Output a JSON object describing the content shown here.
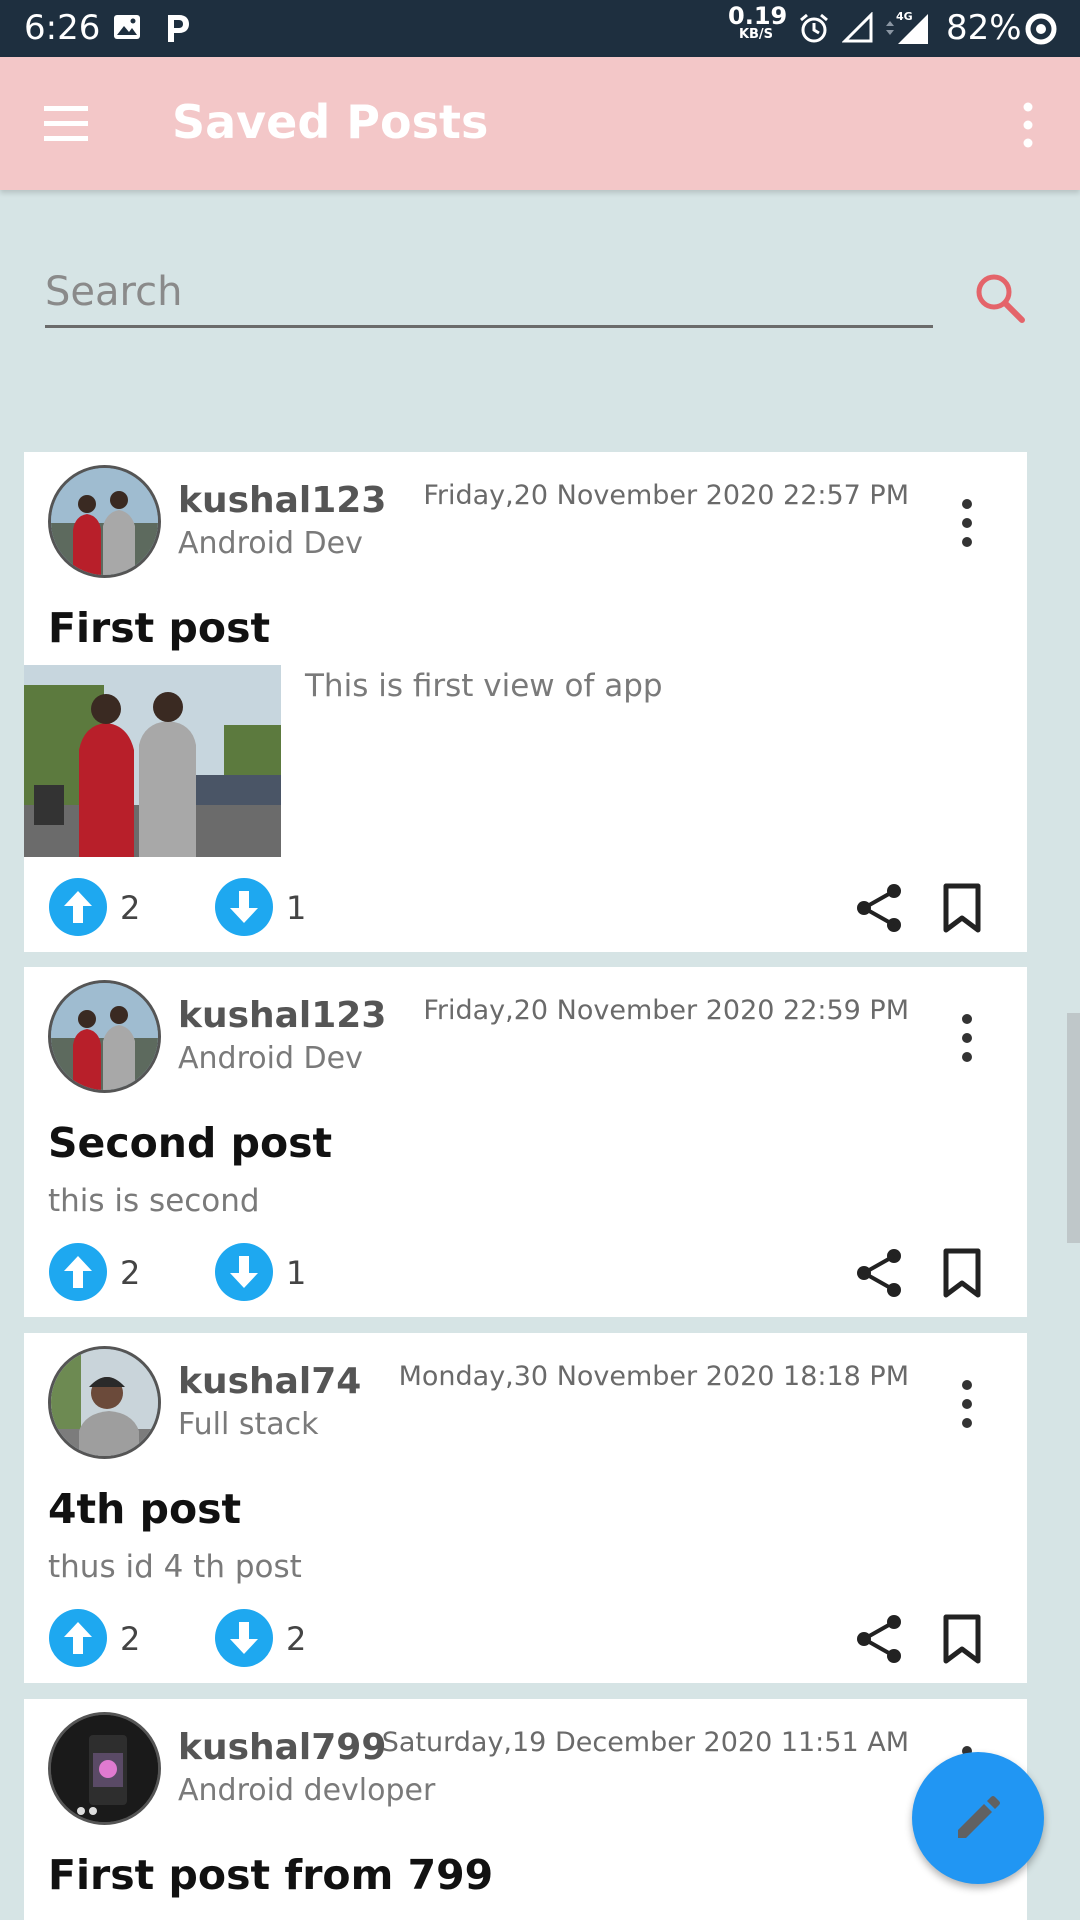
{
  "status_bar": {
    "time": "6:26",
    "net_speed": "0.19",
    "net_unit": "KB/S",
    "network": "4G",
    "battery": "82%"
  },
  "app_bar": {
    "title": "Saved Posts",
    "menu_icon": "hamburger-menu-icon",
    "more_icon": "more-vertical-icon"
  },
  "search": {
    "placeholder": "Search",
    "value": ""
  },
  "posts": [
    {
      "username": "kushal123",
      "role": "Android Dev",
      "datetime": "Friday,20 November 2020 22:57 PM",
      "title": "First post",
      "body": "This is first view of app",
      "upvotes": "2",
      "downvotes": "1"
    },
    {
      "username": "kushal123",
      "role": "Android Dev",
      "datetime": "Friday,20 November 2020 22:59 PM",
      "title": "Second post",
      "body": "this is second",
      "upvotes": "2",
      "downvotes": "1"
    },
    {
      "username": "kushal74",
      "role": "Full stack",
      "datetime": "Monday,30 November 2020 18:18 PM",
      "title": "4th post",
      "body": "thus id 4 th post",
      "upvotes": "2",
      "downvotes": "2"
    },
    {
      "username": "kushal799",
      "role": "Android devloper",
      "datetime": "Saturday,19 December 2020 11:51 AM",
      "title": "First post from 799",
      "body": ""
    }
  ],
  "colors": {
    "app_bar": "#f3c7c8",
    "background": "#d6e4e5",
    "accent": "#2196f3",
    "search_icon": "#e4646a",
    "status_bar": "#1e2f3f"
  },
  "fab": {
    "icon": "edit-pencil-icon"
  }
}
